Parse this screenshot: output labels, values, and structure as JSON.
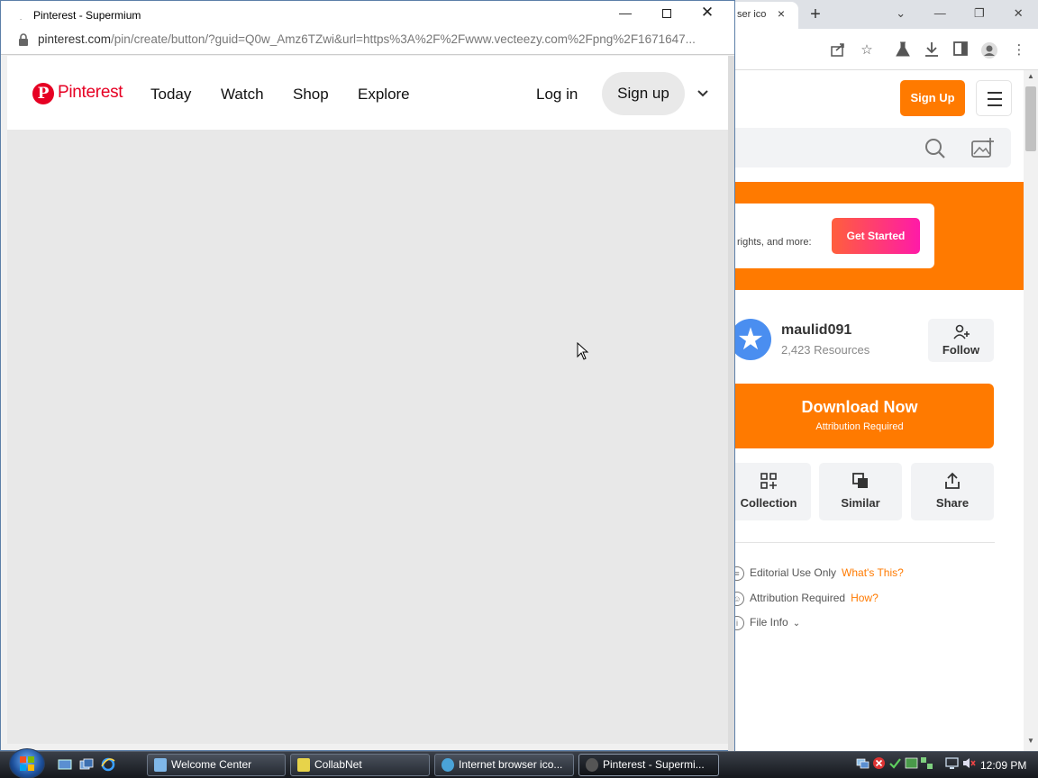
{
  "background_browser": {
    "tab_title": "ser ico",
    "tab_close": "×",
    "new_tab": "+",
    "window_controls": {
      "chevron": "⌄",
      "minimize": "—",
      "restore": "❐",
      "close": "✕"
    },
    "vecteezy": {
      "sign_up": "Sign Up",
      "banner_text": "rights, and more:",
      "get_started": "Get Started",
      "username": "maulid091",
      "resources": "2,423 Resources",
      "follow": "Follow",
      "download_label": "Download Now",
      "download_sub": "Attribution Required",
      "tiles": [
        {
          "label": "Collection",
          "icon": "grid-plus-icon"
        },
        {
          "label": "Similar",
          "icon": "similar-icon"
        },
        {
          "label": "Share",
          "icon": "share-icon"
        }
      ],
      "info": [
        {
          "label": "Editorial Use Only",
          "link": "What's This?"
        },
        {
          "label": "Attribution Required",
          "link": "How?"
        },
        {
          "label": "File Info",
          "link": ""
        }
      ]
    }
  },
  "popup": {
    "window_title": "Pinterest - Supermium",
    "url_main": "pinterest.com",
    "url_rest": "/pin/create/button/?guid=Q0w_Amz6TZwi&url=https%3A%2F%2Fwww.vecteezy.com%2Fpng%2F1671647...",
    "controls": {
      "minimize": "—",
      "close": "✕"
    },
    "pinterest": {
      "logo_glyph": "P",
      "logo_text": "Pinterest",
      "nav": [
        "Today",
        "Watch",
        "Shop",
        "Explore"
      ],
      "login": "Log in",
      "signup": "Sign up"
    }
  },
  "taskbar": {
    "tasks": [
      {
        "label": "Welcome Center",
        "active": false
      },
      {
        "label": "CollabNet",
        "active": false
      },
      {
        "label": "Internet browser ico...",
        "active": false
      },
      {
        "label": "Pinterest - Supermi...",
        "active": true
      }
    ],
    "clock": "12:09 PM"
  },
  "colors": {
    "pinterest_red": "#e60023",
    "vecteezy_orange": "#ff7a00",
    "get_started_gradient": [
      "#ff5f3c",
      "#ff1aa8"
    ]
  }
}
